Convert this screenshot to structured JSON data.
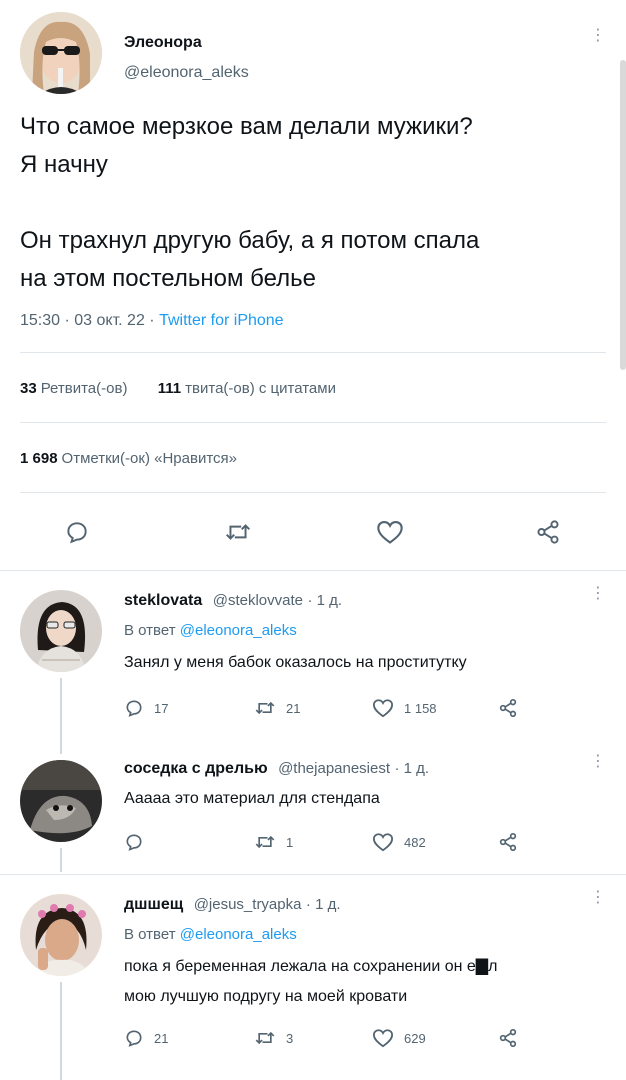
{
  "main_tweet": {
    "author_name": "Элеонора",
    "author_handle": "@eleonora_aleks",
    "text_line1": "Что самое мерзкое вам делали мужики?",
    "text_line2": "Я начну",
    "text_line3": "Он трахнул другую бабу, а я потом спала",
    "text_line4": "на этом постельном белье",
    "time": "15:30",
    "date": "03 окт. 22",
    "source": "Twitter for iPhone",
    "retweets_count": "33",
    "retweets_label": "Ретвита(-ов)",
    "quotes_count": "111",
    "quotes_label": "твита(-ов) с цитатами",
    "likes_count": "1 698",
    "likes_label": "Отметки(-ок) «Нравится»",
    "actions": [
      "reply-icon",
      "retweet-icon",
      "like-icon",
      "share-icon"
    ]
  },
  "replies": [
    {
      "name": "steklovata",
      "handle": "@steklovvate",
      "age": "· 1 д.",
      "replying_prefix": "В ответ",
      "replying_to": "@eleonora_aleks",
      "text_line1": "Занял у меня бабок оказалось на проститутку",
      "text_line2": "",
      "replies": "17",
      "retweets": "21",
      "likes": "1 158"
    },
    {
      "name": "соседка с дрелью",
      "handle": "@thejapanesiest",
      "age": "· 1 д.",
      "replying_prefix": "",
      "replying_to": "",
      "text_line1": "Ааааа это материал для стендапа",
      "text_line2": "",
      "replies": "",
      "retweets": "1",
      "likes": "482"
    },
    {
      "name": "дшшещ",
      "handle": "@jesus_tryapka",
      "age": "· 1 д.",
      "replying_prefix": "В ответ",
      "replying_to": "@eleonora_aleks",
      "text_line1": "пока я беременная лежала на сохранении он е▇л",
      "text_line2": "мою лучшую подругу на моей кровати",
      "replies": "21",
      "retweets": "3",
      "likes": "629"
    }
  ],
  "colors": {
    "text": "#0f1419",
    "secondary": "#536471",
    "link": "#1d9bf0",
    "divider": "#e1e6ea"
  }
}
